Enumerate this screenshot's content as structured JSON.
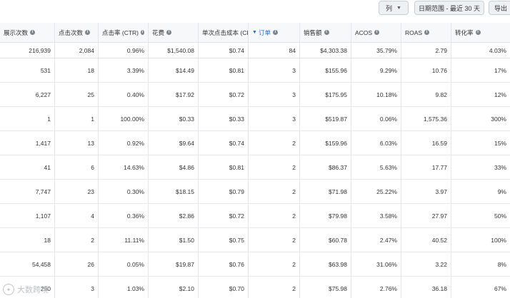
{
  "toolbar": {
    "columns_label": "列",
    "date_range_label": "日期范围 - 最近 30 天",
    "export_label": "导出"
  },
  "table": {
    "headers": [
      "展示次数",
      "点击次数",
      "点击率 (CTR)",
      "花费",
      "单次点击成本 (CPC)",
      "订单",
      "销售额",
      "ACOS",
      "ROAS",
      "转化率"
    ],
    "totals": [
      "216,939",
      "2,084",
      "0.96%",
      "$1,540.08",
      "$0.74",
      "84",
      "$4,303.38",
      "35.79%",
      "2.79",
      "4.03%"
    ],
    "rows": [
      [
        "531",
        "18",
        "3.39%",
        "$14.49",
        "$0.81",
        "3",
        "$155.96",
        "9.29%",
        "10.76",
        "17%"
      ],
      [
        "6,227",
        "25",
        "0.40%",
        "$17.92",
        "$0.72",
        "3",
        "$175.95",
        "10.18%",
        "9.82",
        "12%"
      ],
      [
        "1",
        "1",
        "100.00%",
        "$0.33",
        "$0.33",
        "3",
        "$519.87",
        "0.06%",
        "1,575.36",
        "300%"
      ],
      [
        "1,417",
        "13",
        "0.92%",
        "$9.64",
        "$0.74",
        "2",
        "$159.96",
        "6.03%",
        "16.59",
        "15%"
      ],
      [
        "41",
        "6",
        "14.63%",
        "$4.86",
        "$0.81",
        "2",
        "$86.37",
        "5.63%",
        "17.77",
        "33%"
      ],
      [
        "7,747",
        "23",
        "0.30%",
        "$18.15",
        "$0.79",
        "2",
        "$71.98",
        "25.22%",
        "3.97",
        "9%"
      ],
      [
        "1,107",
        "4",
        "0.36%",
        "$2.86",
        "$0.72",
        "2",
        "$79.98",
        "3.58%",
        "27.97",
        "50%"
      ],
      [
        "18",
        "2",
        "11.11%",
        "$1.50",
        "$0.75",
        "2",
        "$60.78",
        "2.47%",
        "40.52",
        "100%"
      ],
      [
        "54,458",
        "26",
        "0.05%",
        "$19.87",
        "$0.76",
        "2",
        "$63.98",
        "31.06%",
        "3.22",
        "8%"
      ],
      [
        "290",
        "3",
        "1.03%",
        "$2.10",
        "$0.70",
        "2",
        "$75.98",
        "2.76%",
        "36.18",
        "67%"
      ]
    ]
  },
  "watermark": {
    "text": "大数跨境"
  },
  "icons": {
    "info": "info-icon",
    "sort": "sort-down-icon",
    "chevron": "chevron-down-icon"
  }
}
